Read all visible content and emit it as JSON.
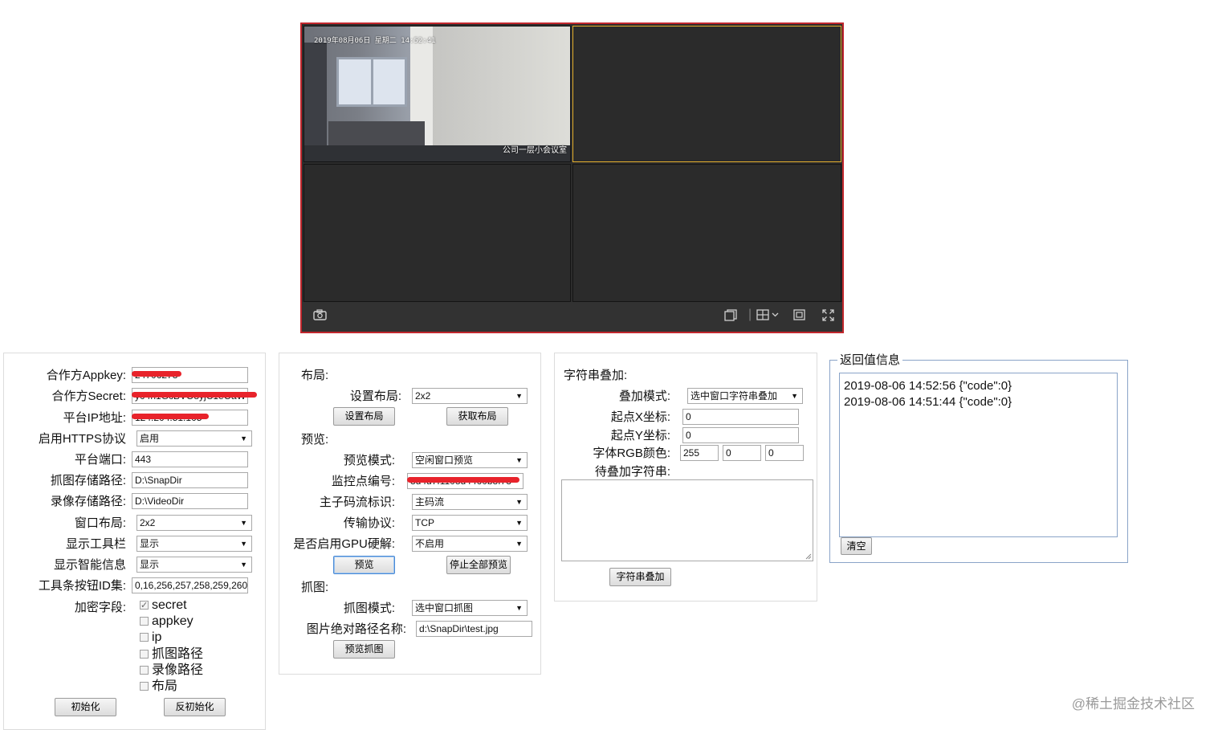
{
  "player": {
    "osd_time": "2019年08月06日 星期二 14:52:41",
    "osd_channel_name": "公司一层小会议室",
    "layout_selected": "2x2"
  },
  "init_panel": {
    "appkey_label": "合作方Appkey:",
    "appkey_value": "24706273",
    "secret_label": "合作方Secret:",
    "secret_value": "y04n1GcBVO8yjC1eOaW",
    "ip_label": "平台IP地址:",
    "ip_value": "124.204.51.105",
    "https_label": "启用HTTPS协议",
    "https_value": "启用",
    "port_label": "平台端口:",
    "port_value": "443",
    "snap_path_label": "抓图存储路径:",
    "snap_path_value": "D:\\SnapDir",
    "video_path_label": "录像存储路径:",
    "video_path_value": "D:\\VideoDir",
    "window_layout_label": "窗口布局:",
    "window_layout_value": "2x2",
    "show_toolbar_label": "显示工具栏",
    "show_toolbar_value": "显示",
    "show_smart_label": "显示智能信息",
    "show_smart_value": "显示",
    "toolbar_ids_label": "工具条按钮ID集:",
    "toolbar_ids_value": "0,16,256,257,258,259,260",
    "encrypt_label": "加密字段:",
    "encrypt_options": [
      {
        "label": "secret",
        "checked": true
      },
      {
        "label": "appkey",
        "checked": false
      },
      {
        "label": "ip",
        "checked": false
      },
      {
        "label": "抓图路径",
        "checked": false
      },
      {
        "label": "录像路径",
        "checked": false
      },
      {
        "label": "布局",
        "checked": false
      }
    ],
    "init_button": "初始化",
    "uninit_button": "反初始化"
  },
  "preview_panel": {
    "layout_section": "布局:",
    "set_layout_label": "设置布局:",
    "set_layout_value": "2x2",
    "set_layout_button": "设置布局",
    "get_layout_button": "获取布局",
    "preview_section": "预览:",
    "preview_mode_label": "预览模式:",
    "preview_mode_value": "空闲窗口预览",
    "camera_code_label": "监控点编号:",
    "camera_code_value": "3d4d7f1108d4460b8f73",
    "stream_label": "主子码流标识:",
    "stream_value": "主码流",
    "protocol_label": "传输协议:",
    "protocol_value": "TCP",
    "gpu_label": "是否启用GPU硬解:",
    "gpu_value": "不启用",
    "preview_button": "预览",
    "stop_all_button": "停止全部预览",
    "snap_section": "抓图:",
    "snap_mode_label": "抓图模式:",
    "snap_mode_value": "选中窗口抓图",
    "snap_path_label": "图片绝对路径名称:",
    "snap_path_value": "d:\\SnapDir\\test.jpg",
    "snap_button": "预览抓图"
  },
  "overlay_panel": {
    "section": "字符串叠加:",
    "mode_label": "叠加模式:",
    "mode_value": "选中窗口字符串叠加",
    "x_label": "起点X坐标:",
    "x_value": "0",
    "y_label": "起点Y坐标:",
    "y_value": "0",
    "rgb_label": "字体RGB颜色:",
    "rgb_r": "255",
    "rgb_g": "0",
    "rgb_b": "0",
    "text_label": "待叠加字符串:",
    "text_value": "",
    "overlay_button": "字符串叠加"
  },
  "return_panel": {
    "legend": "返回值信息",
    "lines": [
      "2019-08-06 14:52:56 {\"code\":0}",
      "2019-08-06 14:51:44 {\"code\":0}"
    ],
    "clear_button": "清空"
  },
  "watermark": "@稀土掘金技术社区",
  "colors": {
    "player_border": "#c1272d",
    "selected_window": "#e6b02c",
    "redaction": "#e8232b"
  }
}
